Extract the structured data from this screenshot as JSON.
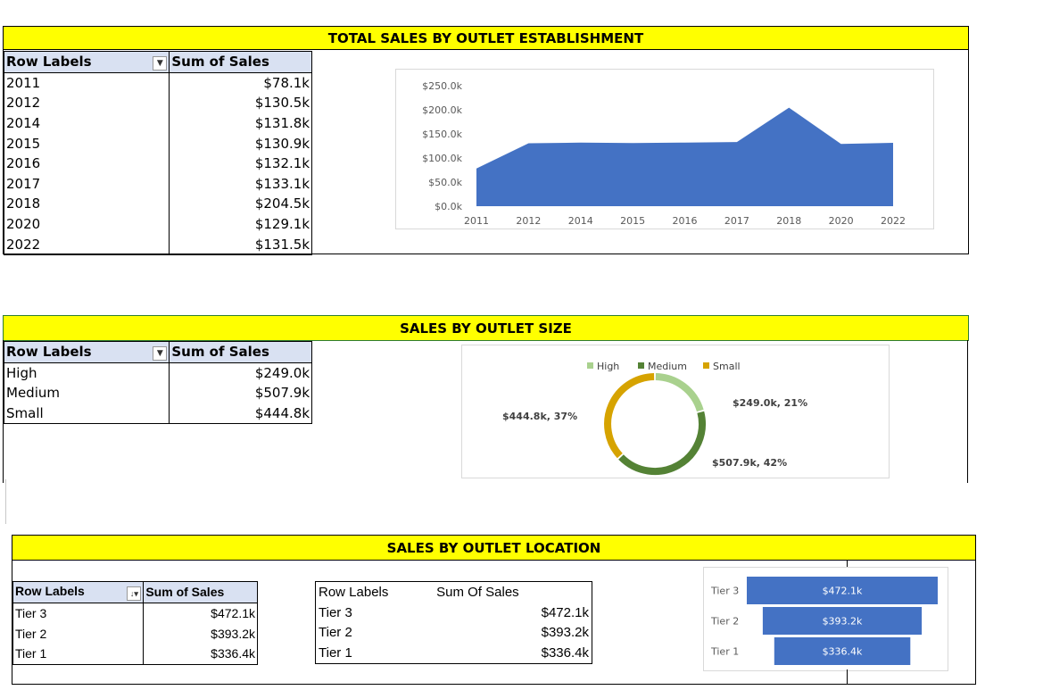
{
  "section1": {
    "title": "TOTAL SALES BY OUTLET ESTABLISHMENT",
    "pivot": {
      "col1": "Row Labels",
      "col2": "Sum of Sales",
      "rows": [
        {
          "label": "2011",
          "value": "$78.1k"
        },
        {
          "label": "2012",
          "value": "$130.5k"
        },
        {
          "label": "2014",
          "value": "$131.8k"
        },
        {
          "label": "2015",
          "value": "$130.9k"
        },
        {
          "label": "2016",
          "value": "$132.1k"
        },
        {
          "label": "2017",
          "value": "$133.1k"
        },
        {
          "label": "2018",
          "value": "$204.5k"
        },
        {
          "label": "2020",
          "value": "$129.1k"
        },
        {
          "label": "2022",
          "value": "$131.5k"
        }
      ]
    }
  },
  "section2": {
    "title": "SALES BY OUTLET SIZE",
    "pivot": {
      "col1": "Row Labels",
      "col2": "Sum of Sales",
      "rows": [
        {
          "label": "High",
          "value": "$249.0k"
        },
        {
          "label": "Medium",
          "value": "$507.9k"
        },
        {
          "label": "Small",
          "value": "$444.8k"
        }
      ]
    }
  },
  "section3": {
    "title": "SALES BY OUTLET LOCATION",
    "pivot": {
      "col1": "Row Labels",
      "col2": "Sum of Sales",
      "rows": [
        {
          "label": "Tier 3",
          "value": "$472.1k"
        },
        {
          "label": "Tier 2",
          "value": "$393.2k"
        },
        {
          "label": "Tier 1",
          "value": "$336.4k"
        }
      ]
    },
    "plain_table": {
      "col1": "Row Labels",
      "col2": "Sum Of Sales",
      "rows": [
        {
          "label": "Tier 3",
          "value": "$472.1k"
        },
        {
          "label": "Tier 2",
          "value": "$393.2k"
        },
        {
          "label": "Tier 1",
          "value": "$336.4k"
        }
      ]
    }
  },
  "chart_data": [
    {
      "type": "area",
      "title": "",
      "categories": [
        "2011",
        "2012",
        "2014",
        "2015",
        "2016",
        "2017",
        "2018",
        "2020",
        "2022"
      ],
      "values": [
        78.1,
        130.5,
        131.8,
        130.9,
        132.1,
        133.1,
        204.5,
        129.1,
        131.5
      ],
      "unit": "thousand USD",
      "ylim": [
        0,
        250
      ],
      "yticks": [
        "$0.0k",
        "$50.0k",
        "$100.0k",
        "$150.0k",
        "$200.0k",
        "$250.0k"
      ],
      "grid": false,
      "color": "#4472c4"
    },
    {
      "type": "pie",
      "style": "doughnut",
      "legend": [
        "High",
        "Medium",
        "Small"
      ],
      "legend_position": "top",
      "values": [
        249.0,
        507.9,
        444.8
      ],
      "data_labels": [
        "$249.0k, 21%",
        "$507.9k, 42%",
        "$444.8k, 37%"
      ],
      "colors": [
        "#a9d18e",
        "#548235",
        "#d6a300"
      ]
    },
    {
      "type": "bar",
      "orientation": "horizontal",
      "style": "funnel",
      "categories": [
        "Tier 3",
        "Tier 2",
        "Tier 1"
      ],
      "values": [
        472.1,
        393.2,
        336.4
      ],
      "data_labels": [
        "$472.1k",
        "$393.2k",
        "$336.4k"
      ],
      "color": "#4472c4"
    }
  ]
}
